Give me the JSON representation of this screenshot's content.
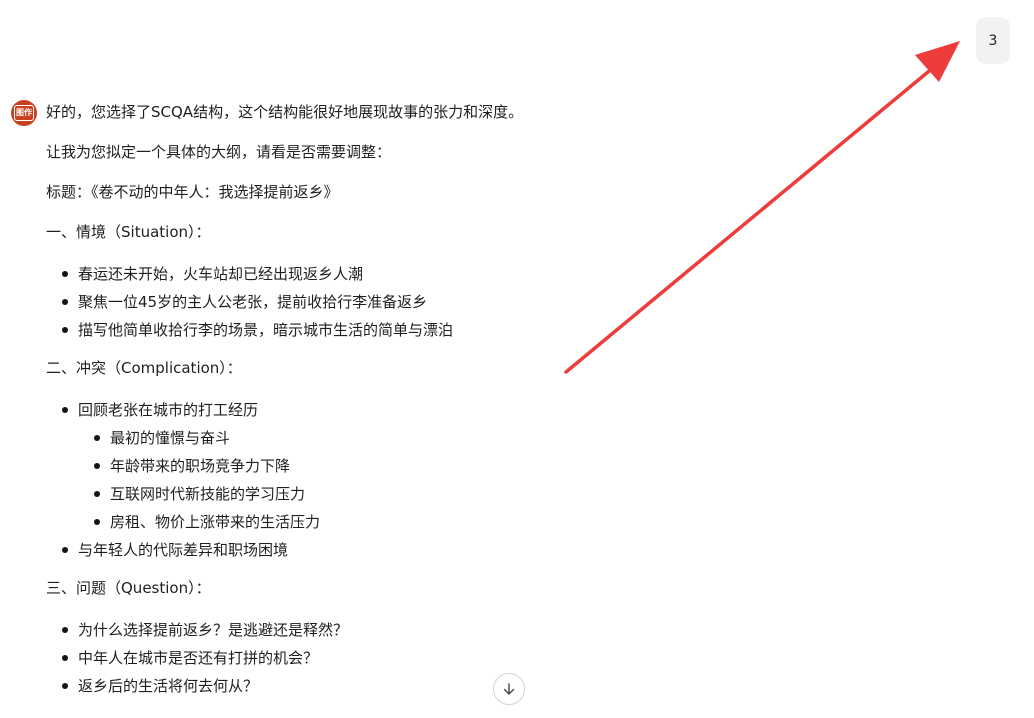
{
  "user_message": {
    "text": "3"
  },
  "assistant": {
    "avatar_label": "图作",
    "intro": "好的，您选择了SCQA结构，这个结构能很好地展现故事的张力和深度。",
    "lead": "让我为您拟定一个具体的大纲，请看是否需要调整：",
    "title_line": "标题：《卷不动的中年人：我选择提前返乡》",
    "sections": [
      {
        "heading": "一、情境（Situation）：",
        "items": [
          "春运还未开始，火车站却已经出现返乡人潮",
          "聚焦一位45岁的主人公老张，提前收拾行李准备返乡",
          "描写他简单收拾行李的场景，暗示城市生活的简单与漂泊"
        ]
      },
      {
        "heading": "二、冲突（Complication）：",
        "items": [
          "回顾老张在城市的打工经历",
          "与年轻人的代际差异和职场困境"
        ],
        "subitems": [
          "最初的憧憬与奋斗",
          "年龄带来的职场竞争力下降",
          "互联网时代新技能的学习压力",
          "房租、物价上涨带来的生活压力"
        ]
      },
      {
        "heading": "三、问题（Question）：",
        "items": [
          "为什么选择提前返乡？是逃避还是释然？",
          "中年人在城市是否还有打拼的机会？",
          "返乡后的生活将何去何从？"
        ]
      }
    ]
  },
  "icons": {
    "scroll_down": "arrow-down-icon",
    "annotation": "red-arrow-annotation"
  },
  "colors": {
    "bubble_bg": "#f2f2f2",
    "avatar_bg": "#c7411e",
    "annotation_arrow": "#ee3b3b"
  }
}
